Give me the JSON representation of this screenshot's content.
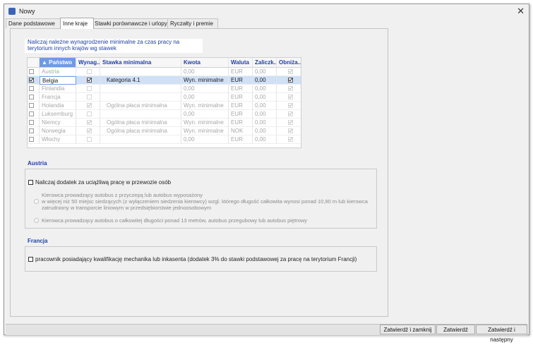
{
  "window": {
    "title": "Nowy"
  },
  "tabs": [
    {
      "label": "Dane podstawowe"
    },
    {
      "label": "Inne kraje"
    },
    {
      "label": "Stawki porównawcze i urlopy"
    },
    {
      "label": "Ryczałty i premie"
    }
  ],
  "note": "Naliczaj należne wynagrodzenie minimalne za czas pracy na terytorium innych krajów wg stawek",
  "grid": {
    "columns": [
      "▲ Państwo",
      "Wynag...",
      "Stawka minimalna",
      "Kwota",
      "Waluta",
      "Zaliczk...",
      "Obniża..."
    ],
    "rows": [
      {
        "include": false,
        "country": "Austria",
        "wynag": false,
        "stawka": "",
        "kwota": "0,00",
        "waluta": "EUR",
        "zaliczka": "0,00",
        "obniza": true
      },
      {
        "include": true,
        "country": "Belgia",
        "wynag": true,
        "stawka": "Kategoria 4.1",
        "kwota": "Wyn. minimalne",
        "waluta": "EUR",
        "zaliczka": "0,00",
        "obniza": true
      },
      {
        "include": false,
        "country": "Finlandia",
        "wynag": false,
        "stawka": "",
        "kwota": "0,00",
        "waluta": "EUR",
        "zaliczka": "0,00",
        "obniza": true
      },
      {
        "include": false,
        "country": "Francja",
        "wynag": false,
        "stawka": "",
        "kwota": "0,00",
        "waluta": "EUR",
        "zaliczka": "0,00",
        "obniza": true
      },
      {
        "include": false,
        "country": "Holandia",
        "wynag": true,
        "stawka": "Ogólna płaca minimalna",
        "kwota": "Wyn. minimalne",
        "waluta": "EUR",
        "zaliczka": "0,00",
        "obniza": true
      },
      {
        "include": false,
        "country": "Luksemburg",
        "wynag": false,
        "stawka": "",
        "kwota": "0,00",
        "waluta": "EUR",
        "zaliczka": "0,00",
        "obniza": true
      },
      {
        "include": false,
        "country": "Niemcy",
        "wynag": true,
        "stawka": "Ogólna płaca minimalna",
        "kwota": "Wyn. minimalne",
        "waluta": "EUR",
        "zaliczka": "0,00",
        "obniza": true
      },
      {
        "include": false,
        "country": "Norwegia",
        "wynag": true,
        "stawka": "Ogólna płaca minimalna",
        "kwota": "Wyn. minimalne",
        "waluta": "NOK",
        "zaliczka": "0,00",
        "obniza": true
      },
      {
        "include": false,
        "country": "Włochy",
        "wynag": false,
        "stawka": "",
        "kwota": "0,00",
        "waluta": "EUR",
        "zaliczka": "0,00",
        "obniza": true
      }
    ]
  },
  "austria": {
    "title": "Austria",
    "checkbox_label": "Naliczaj dodatek za uciążliwą pracę w przewozie osób",
    "option1": "Kierowca prowadzący autobus z przyczepą lub autobus wyposażony w więcej niż 50 miejsc siedzących (z wyłączeniem siedzenia kierowcy) wzgl. którego długość całkowita wynosi ponad 10,90 m lub kierowca zatrudniony w transporcie liniowym w przedsiębiorstwie jednoosobowym",
    "option1_lines": [
      "Kierowca prowadzący autobus z przyczepą lub autobus wyposażony",
      "w więcej niż 50 miejsc siedzących (z wyłączeniem siedzenia kierowcy) wzgl. którego długość całkowita wynosi ponad 10,90 m lub kierowca",
      "zatrudniony w transporcie liniowym w przedsiębiorstwie jednoosobowym"
    ],
    "option2": "Kierowca prowadzący autobus o całkowitej długości ponad 13 metrów, autobus przegubowy lub autobus piętrowy"
  },
  "francja": {
    "title": "Francja",
    "checkbox_label": "pracownik posiadający kwalifikację mechanika lub inkasenta (dodatek 3% do stawki podstawowej za pracę na terytorium Francji)"
  },
  "buttons": {
    "confirm_close": "Zatwierdź i zamknij",
    "confirm": "Zatwierdź",
    "confirm_next": "Zatwierdź i następny"
  },
  "colors": {
    "accent": "#1f3fa3",
    "selection": "#cfe0f7",
    "header_sort": "#6e9ae6"
  }
}
